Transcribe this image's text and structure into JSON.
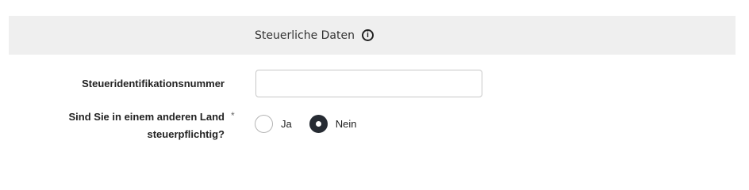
{
  "section": {
    "title": "Steuerliche Daten",
    "info_icon": "info-icon"
  },
  "form": {
    "tax_id": {
      "label": "Steueridentifikationsnummer",
      "value": "",
      "placeholder": ""
    },
    "taxable_abroad": {
      "label_line1": "Sind Sie in einem anderen Land",
      "label_line2": "steuerpflichtig?",
      "required_marker": "*",
      "options": [
        {
          "label": "Ja",
          "checked": false
        },
        {
          "label": "Nein",
          "checked": true
        }
      ]
    }
  },
  "colors": {
    "header_bg": "#efefef",
    "radio_checked": "#262b33"
  }
}
